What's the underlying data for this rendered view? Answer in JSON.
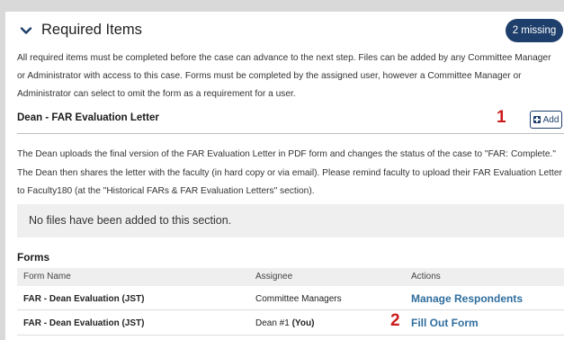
{
  "header": {
    "title": "Required Items",
    "badge": "2 missing",
    "description": "All required items must be completed before the case can advance to the next step. Files can be added by any Committee Manager or Administrator with access to this case. Forms must be completed by the assigned user, however a Committee Manager or Administrator can select to omit the form as a requirement for a user."
  },
  "section": {
    "title": "Dean - FAR Evaluation Letter",
    "marker": "1",
    "add_label": "Add",
    "description": "The Dean uploads the final version of the FAR Evaluation Letter in PDF form and changes the status of the case to \"FAR: Complete.\" The Dean then shares the letter with the faculty (in hard copy or via email). Please remind faculty to upload their FAR Evaluation Letter to Faculty180 (at the \"Historical FARs & FAR Evaluation Letters\" section).",
    "empty_text": "No files have been added to this section."
  },
  "forms": {
    "title": "Forms",
    "columns": [
      "Form Name",
      "Assignee",
      "Actions"
    ],
    "rows": [
      {
        "name": "FAR - Dean Evaluation (JST)",
        "assignee": "Committee Managers",
        "assignee_suffix": "",
        "marker": "",
        "action": "Manage Respondents"
      },
      {
        "name": "FAR - Dean Evaluation (JST)",
        "assignee": "Dean #1",
        "assignee_suffix": "(You)",
        "marker": "2",
        "action": "Fill Out Form"
      }
    ]
  },
  "colors": {
    "accent": "#1e3f6b",
    "link": "#2f6e9e",
    "marker": "#cc1c1c"
  }
}
